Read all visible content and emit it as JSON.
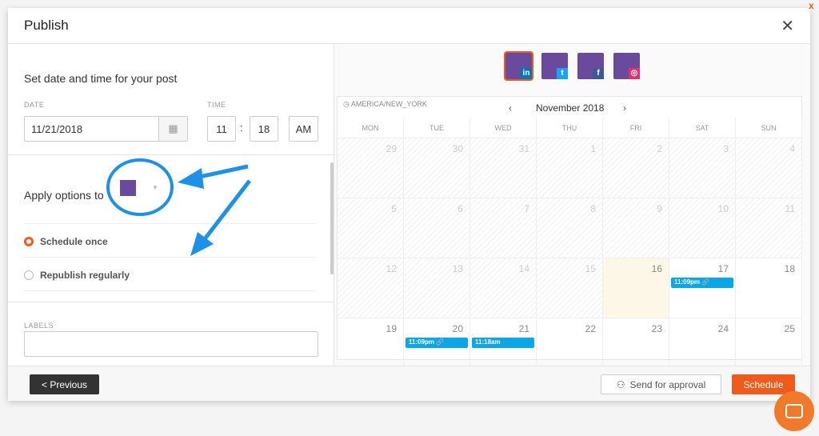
{
  "window": {
    "title": "Publish",
    "close_icon": "close-icon",
    "outer_close": "x"
  },
  "left": {
    "heading": "Set date and time for your post",
    "date_label": "DATE",
    "date_value": "11/21/2018",
    "time_label": "TIME",
    "hour": "11",
    "sep": ":",
    "minute": "18",
    "ampm": "AM",
    "apply_label": "Apply options to",
    "schedule_once": "Schedule once",
    "republish": "Republish regularly",
    "labels_label": "LABELS"
  },
  "accounts": [
    {
      "network": "linkedin",
      "badge": "in",
      "color": "#0077b5",
      "selected": true
    },
    {
      "network": "twitter",
      "badge": "t",
      "color": "#1da1f2"
    },
    {
      "network": "facebook",
      "badge": "f",
      "color": "#3b5998"
    },
    {
      "network": "instagram",
      "badge": "◎",
      "color": "#e1306c"
    }
  ],
  "calendar": {
    "timezone": "AMERICA/NEW_YORK",
    "month": "November 2018",
    "days": [
      "MON",
      "TUE",
      "WED",
      "THU",
      "FRI",
      "SAT",
      "SUN"
    ],
    "weeks": [
      [
        "29",
        "30",
        "31",
        "1",
        "2",
        "3",
        "4"
      ],
      [
        "5",
        "6",
        "7",
        "8",
        "9",
        "10",
        "11"
      ],
      [
        "12",
        "13",
        "14",
        "15",
        "16",
        "17",
        "18"
      ],
      [
        "19",
        "20",
        "21",
        "22",
        "23",
        "24",
        "25"
      ]
    ],
    "today": "16",
    "events": [
      {
        "day": "17",
        "time": "11:09pm 🔗"
      },
      {
        "day": "20",
        "time": "11:09pm 🔗"
      },
      {
        "day": "21",
        "time": "11:18am"
      }
    ]
  },
  "footer": {
    "previous": "< Previous",
    "approval": "Send for approval",
    "schedule": "Schedule"
  },
  "colors": {
    "accent": "#f05a1a",
    "event": "#0aa6e6",
    "annotation": "#1e90e8"
  }
}
